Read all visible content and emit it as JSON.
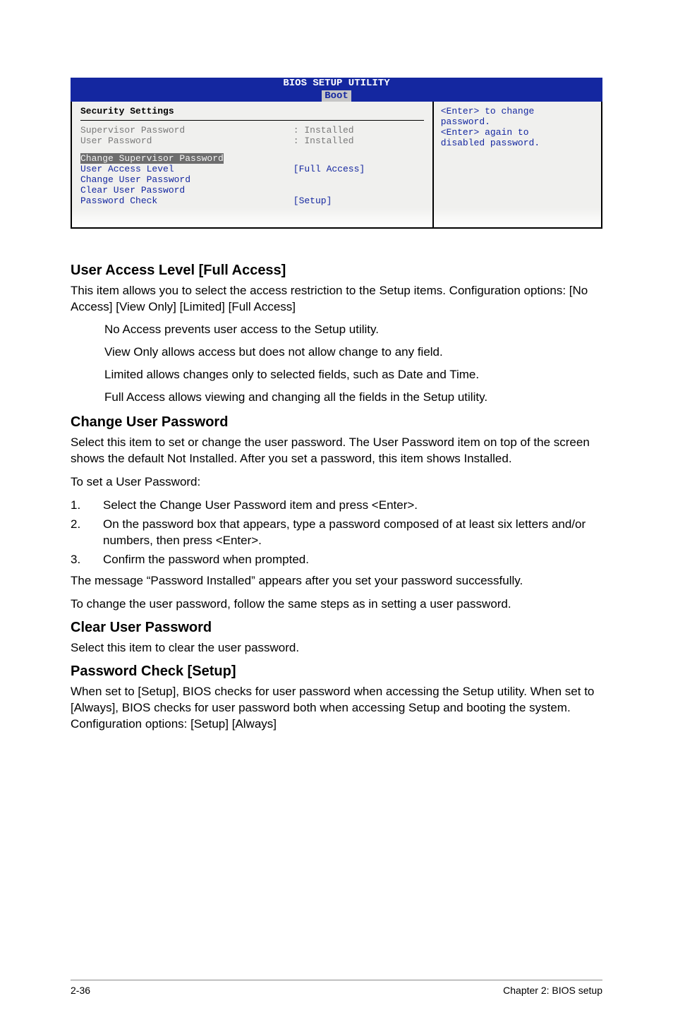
{
  "bios": {
    "title": "BIOS SETUP UTILITY",
    "tab": "Boot",
    "section_title": "Security Settings",
    "supervisor_label": "Supervisor Password",
    "supervisor_value": ": Installed",
    "user_pw_label": "User Password",
    "user_pw_value": ": Installed",
    "change_supervisor": "Change Supervisor Password",
    "user_access_label": "User Access Level",
    "user_access_value": "[Full Access]",
    "change_user_pw": "Change User Password",
    "clear_user_pw": "Clear User Password",
    "pw_check_label": "Password Check",
    "pw_check_value": "[Setup]",
    "help_l1": "<Enter> to change",
    "help_l2": "password.",
    "help_l3": "<Enter> again to",
    "help_l4": "disabled password."
  },
  "sections": {
    "ual_heading": "User Access Level [Full Access]",
    "ual_p1": "This item allows you to select the access restriction to the Setup items. Configuration options: [No Access] [View Only] [Limited] [Full Access]",
    "ual_no_access": "No Access prevents user access to the Setup utility.",
    "ual_view_only": "View Only allows access but does not allow change to any field.",
    "ual_limited": "Limited allows changes only to selected fields, such as Date and Time.",
    "ual_full": "Full Access allows viewing and changing all the fields in the Setup utility.",
    "cup_heading": "Change User Password",
    "cup_p1": "Select this item to set or change the user password. The User Password item on top of the screen shows the default Not Installed. After you set a password, this item shows Installed.",
    "cup_p2": "To set a User Password:",
    "cup_step1": "Select the Change User Password item and press <Enter>.",
    "cup_step2": "On the password box that appears, type a password composed of at least six letters and/or numbers, then press <Enter>.",
    "cup_step3": "Confirm the password when prompted.",
    "cup_p3": "The message “Password Installed” appears after you set your password successfully.",
    "cup_p4": "To change the user password, follow the same steps as in setting a user password.",
    "clup_heading": "Clear User Password",
    "clup_p1": "Select this item to clear the user password.",
    "pwc_heading": "Password Check [Setup]",
    "pwc_p1": "When set to [Setup], BIOS checks for user password when accessing the Setup utility. When set to [Always], BIOS checks for user password both when accessing Setup and booting the system. Configuration options: [Setup] [Always]"
  },
  "steps": {
    "n1": "1.",
    "n2": "2.",
    "n3": "3."
  },
  "footer": {
    "page": "2-36",
    "chapter": "Chapter 2: BIOS setup"
  }
}
